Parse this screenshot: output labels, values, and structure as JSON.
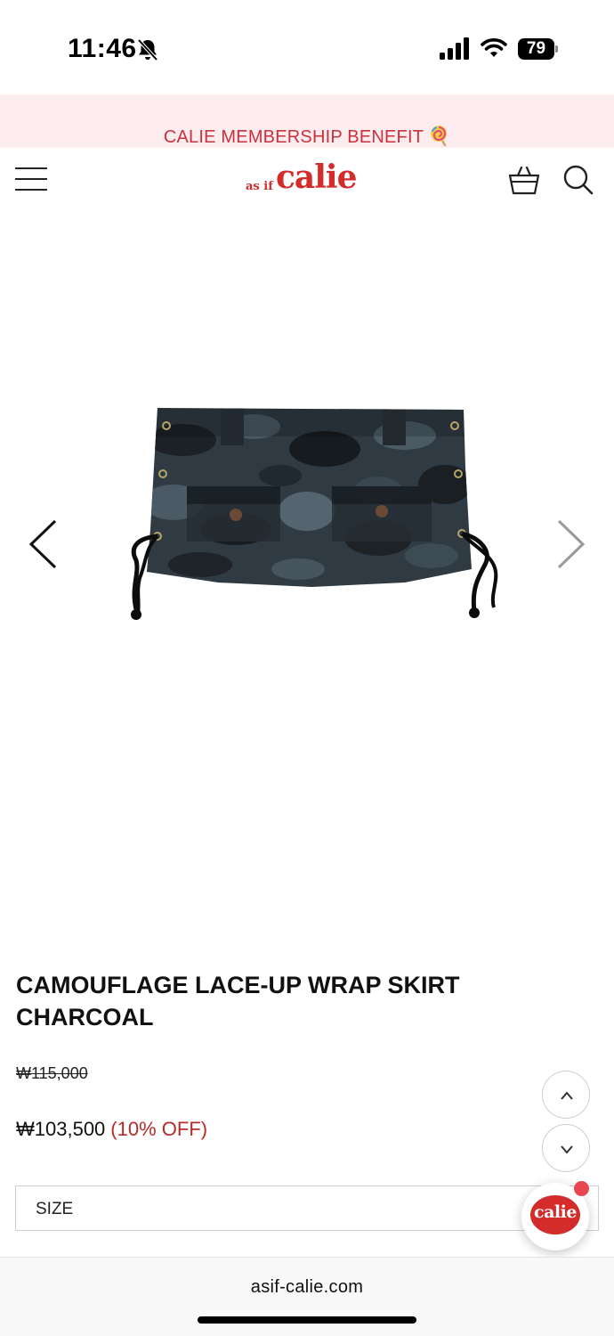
{
  "status_bar": {
    "time": "11:46",
    "battery": "79",
    "icons": [
      "bell-slash-icon",
      "signal-icon",
      "wifi-icon",
      "battery-icon"
    ]
  },
  "banner": {
    "text": "CALIE MEMBERSHIP BENEFIT",
    "icon": "lollipop-icon",
    "background": "#fdecee",
    "color": "#c8323f"
  },
  "header": {
    "logo_small": "as if",
    "logo_big": "calie",
    "brand_color": "#d42b2b",
    "icons": [
      "menu-icon",
      "cart-icon",
      "search-icon"
    ]
  },
  "gallery": {
    "image": "camouflage-skirt-image",
    "prev": "chevron-left-icon",
    "next": "chevron-right-icon"
  },
  "product": {
    "title": "CAMOUFLAGE LACE-UP WRAP SKIRT CHARCOAL",
    "original_price": "₩115,000",
    "sale_price": "₩103,500",
    "discount": "(10% OFF)",
    "discount_color": "#b72a2a"
  },
  "options": {
    "size_label": "SIZE"
  },
  "floating": {
    "chat_label": "calie",
    "scroll_up": "chevron-up-icon",
    "scroll_down": "chevron-down-icon"
  },
  "browser": {
    "url": "asif-calie.com"
  }
}
